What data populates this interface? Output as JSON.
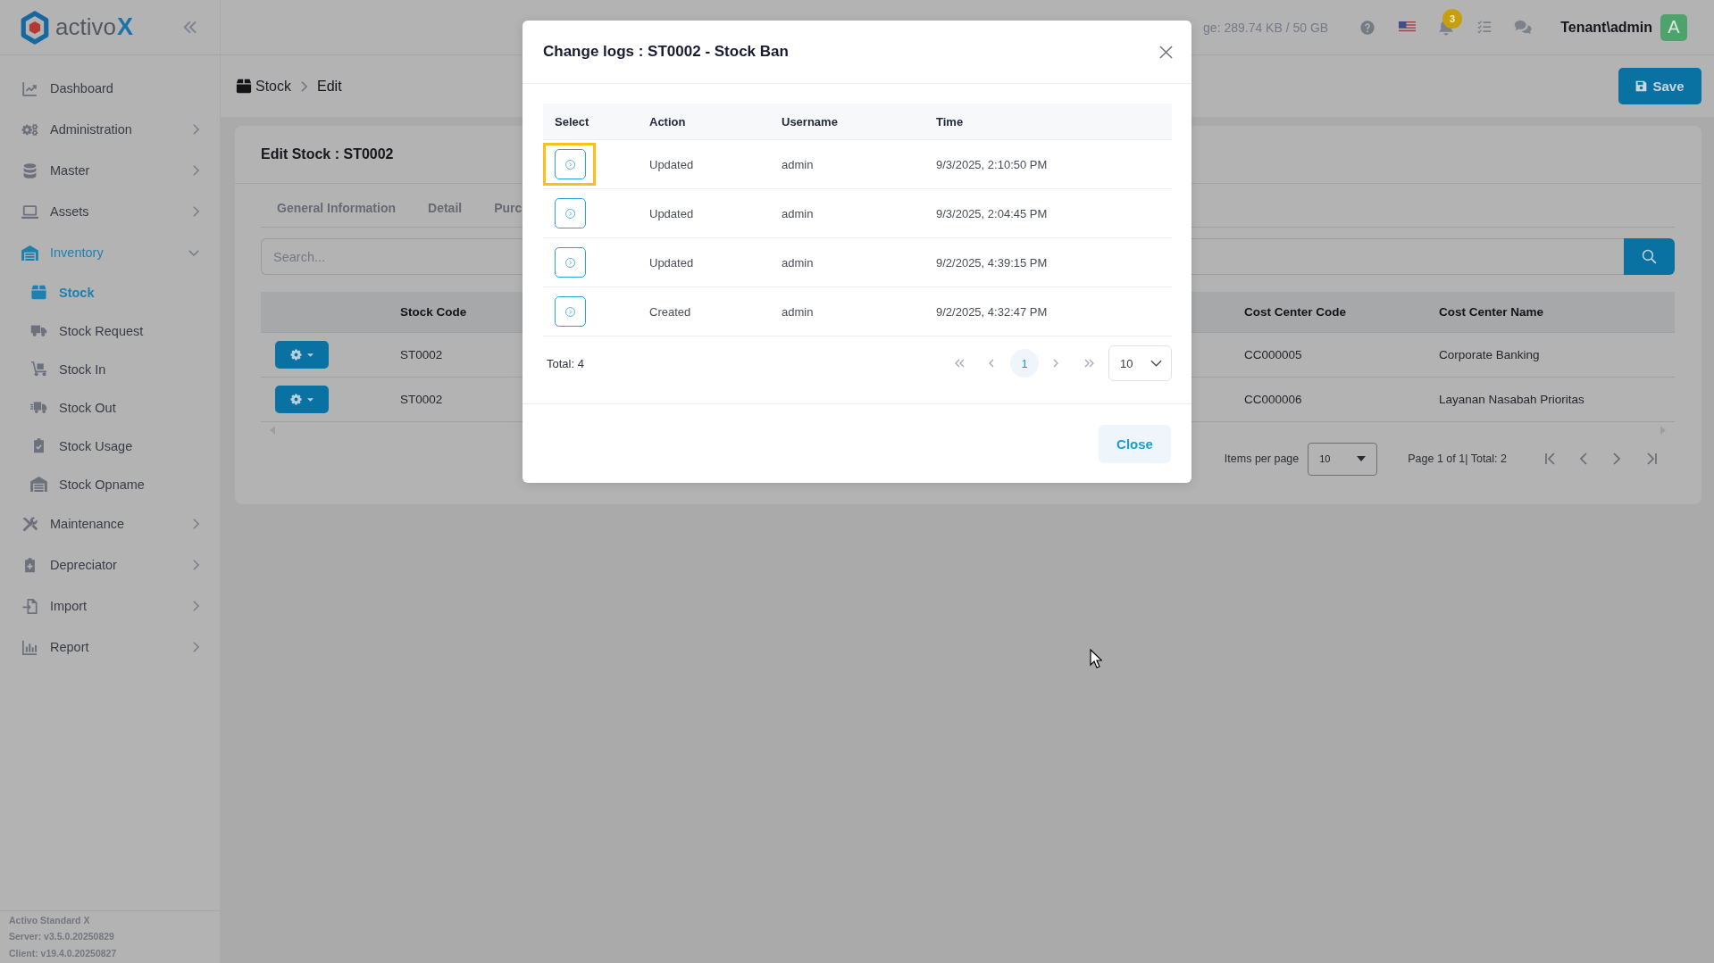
{
  "sidebar": {
    "brand": "activo",
    "brand_accent": "X",
    "items": [
      {
        "label": "Dashboard",
        "selected": false
      },
      {
        "label": "Administration",
        "selected": false,
        "expanded": false
      },
      {
        "label": "Master",
        "selected": false,
        "expanded": false
      },
      {
        "label": "Assets",
        "selected": false,
        "expanded": false
      },
      {
        "label": "Inventory",
        "selected": true,
        "expanded": true,
        "children": [
          {
            "label": "Stock",
            "selected": true
          },
          {
            "label": "Stock Request",
            "selected": false
          },
          {
            "label": "Stock In",
            "selected": false
          },
          {
            "label": "Stock Out",
            "selected": false
          },
          {
            "label": "Stock Usage",
            "selected": false
          },
          {
            "label": "Stock Opname",
            "selected": false
          }
        ]
      },
      {
        "label": "Maintenance",
        "selected": false,
        "expanded": false
      },
      {
        "label": "Depreciator",
        "selected": false,
        "expanded": false
      },
      {
        "label": "Import",
        "selected": false,
        "expanded": false
      },
      {
        "label": "Report",
        "selected": false,
        "expanded": false
      }
    ],
    "footer": [
      "Activo Standard X",
      "Server: v3.5.0.20250829",
      "Client: v19.4.0.20250827"
    ]
  },
  "topbar": {
    "storage": "ge: 289.74 KB / 50 GB",
    "notification_count": "3",
    "user": "Tenant\\admin",
    "avatar": "A"
  },
  "breadcrumb": [
    "Stock",
    "Edit"
  ],
  "save_button": "Save",
  "edit_card": {
    "title": "Edit Stock : ST0002",
    "tabs": [
      {
        "label": "General Information",
        "selected": false
      },
      {
        "label": "Detail",
        "selected": false
      },
      {
        "label": "Purc",
        "selected": false
      }
    ],
    "search": {
      "placeholder": "Search..."
    },
    "table": {
      "columns": [
        "Stock Code",
        "Cost Center Code",
        "Cost Center Name"
      ],
      "rows": [
        {
          "cells": [
            "ST0002",
            "CC000005",
            "Corporate Banking"
          ]
        },
        {
          "cells": [
            "ST0002",
            "CC000006",
            "Layanan Nasabah Prioritas"
          ]
        }
      ]
    },
    "paginator": {
      "items_per_page_label": "Items per page",
      "page_size": "10",
      "range": "Page 1 of 1| Total: 2"
    }
  },
  "change_log_dialog": {
    "title": "Change logs : ST0002 - Stock Ban",
    "select_column": "Select",
    "columns": [
      "Action",
      "Username",
      "Time"
    ],
    "rows": [
      {
        "cells": [
          "Updated",
          "admin",
          "9/3/2025, 2:10:50 PM"
        ],
        "highlighted": true
      },
      {
        "cells": [
          "Updated",
          "admin",
          "9/3/2025, 2:04:45 PM"
        ],
        "highlighted": false
      },
      {
        "cells": [
          "Updated",
          "admin",
          "9/2/2025, 4:39:15 PM"
        ],
        "highlighted": false
      },
      {
        "cells": [
          "Created",
          "admin",
          "9/2/2025, 4:32:47 PM"
        ],
        "highlighted": false
      }
    ],
    "total": "Total: 4",
    "pages": [
      {
        "label": "1",
        "selected": true
      }
    ],
    "page_size": "10",
    "close_button": "Close"
  }
}
